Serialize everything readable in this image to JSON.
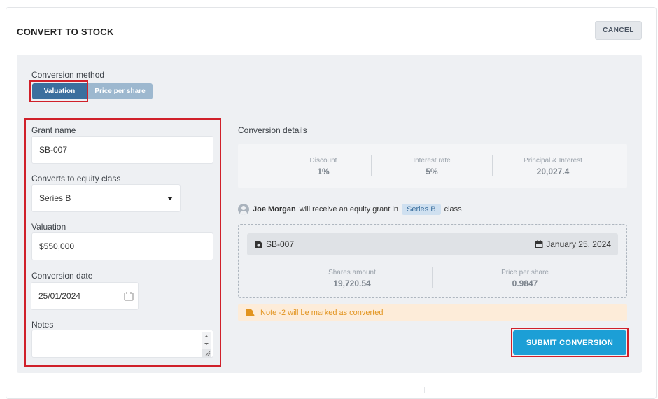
{
  "header": {
    "title": "CONVERT TO STOCK",
    "cancel_label": "CANCEL"
  },
  "method": {
    "label": "Conversion method",
    "options": [
      {
        "label": "Valuation",
        "selected": true
      },
      {
        "label": "Price per share",
        "selected": false
      }
    ]
  },
  "form": {
    "grant_name": {
      "label": "Grant name",
      "value": "SB-007"
    },
    "equity_class": {
      "label": "Converts to equity class",
      "value": "Series B"
    },
    "valuation": {
      "label": "Valuation",
      "value": "$550,000"
    },
    "conversion_date": {
      "label": "Conversion date",
      "value": "25/01/2024"
    },
    "notes": {
      "label": "Notes",
      "value": ""
    }
  },
  "details": {
    "label": "Conversion details",
    "stats": [
      {
        "key": "Discount",
        "value": "1%"
      },
      {
        "key": "Interest rate",
        "value": "5%"
      },
      {
        "key": "Principal & Interest",
        "value": "20,027.4"
      }
    ]
  },
  "grant": {
    "holder": "Joe Morgan",
    "text_mid": "will receive an equity grant in",
    "class_tag": "Series B",
    "text_end": "class",
    "grant_id": "SB-007",
    "date": "January 25, 2024",
    "shares_label": "Shares amount",
    "shares_value": "19,720.54",
    "pps_label": "Price per share",
    "pps_value": "0.9847"
  },
  "note": {
    "text": "Note -2 will be marked as converted"
  },
  "submit_label": "SUBMIT CONVERSION",
  "colors": {
    "accent": "#1c9fd6",
    "segment_active": "#3b6f9e",
    "segment_inactive": "#9db8cf",
    "highlight": "#d0202a",
    "note_bg": "#fdecd9",
    "note_text": "#e2941f"
  }
}
